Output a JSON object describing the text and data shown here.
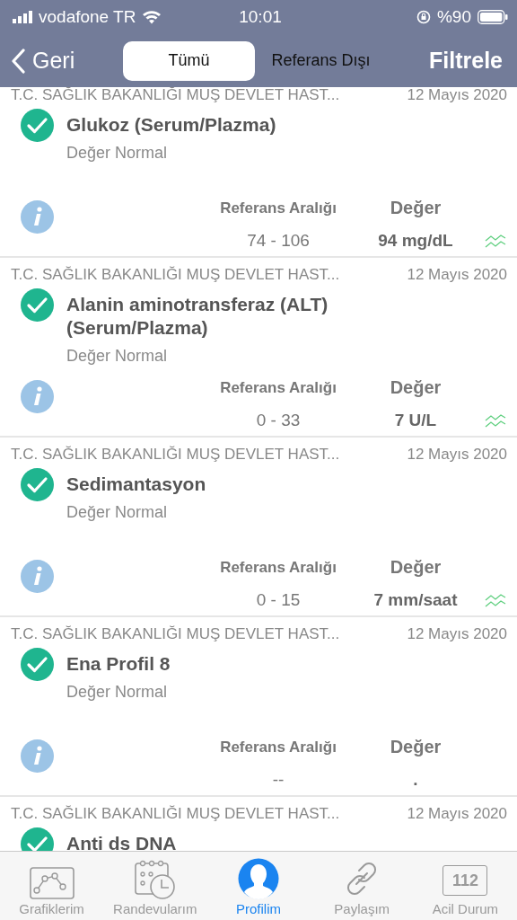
{
  "status_bar": {
    "carrier": "vodafone TR",
    "time": "10:01",
    "battery": "%90"
  },
  "nav": {
    "back": "Geri",
    "action": "Filtrele",
    "tabs": [
      {
        "label": "Tümü",
        "selected": true
      },
      {
        "label": "Referans Dışı",
        "selected": false
      }
    ]
  },
  "results": [
    {
      "source": "T.C. SAĞLIK BAKANLIĞI MUŞ DEVLET HAST...",
      "date": "12 Mayıs 2020",
      "title": "Glukoz (Serum/Plazma)",
      "normal": true,
      "status_text": "Değer Normal",
      "ref_label": "Referans Aralığı",
      "value_label": "Değer",
      "ref": "74 - 106",
      "value": "94 mg/dL",
      "trend": true
    },
    {
      "source": "T.C. SAĞLIK BAKANLIĞI MUŞ DEVLET HAST...",
      "date": "12 Mayıs 2020",
      "title": "Alanin aminotransferaz (ALT) (Serum/Plazma)",
      "normal": true,
      "status_text": "Değer Normal",
      "ref_label": "Referans Aralığı",
      "value_label": "Değer",
      "ref": "0 - 33",
      "value": "7 U/L",
      "trend": true
    },
    {
      "source": "T.C. SAĞLIK BAKANLIĞI MUŞ DEVLET HAST...",
      "date": "12 Mayıs 2020",
      "title": "Sedimantasyon",
      "normal": true,
      "status_text": "Değer Normal",
      "ref_label": "Referans Aralığı",
      "value_label": "Değer",
      "ref": "0 - 15",
      "value": "7 mm/saat",
      "trend": true
    },
    {
      "source": "T.C. SAĞLIK BAKANLIĞI MUŞ DEVLET HAST...",
      "date": "12 Mayıs 2020",
      "title": "Ena Profil 8",
      "normal": true,
      "status_text": "Değer Normal",
      "ref_label": "Referans Aralığı",
      "value_label": "Değer",
      "ref": "--",
      "value": ".",
      "trend": false
    },
    {
      "source": "T.C. SAĞLIK BAKANLIĞI MUŞ DEVLET HAST...",
      "date": "12 Mayıs 2020",
      "title": "Anti ds DNA",
      "normal": true
    }
  ],
  "tab_bar": [
    {
      "label": "Grafiklerim",
      "kind": "chart",
      "selected": false
    },
    {
      "label": "Randevularım",
      "kind": "calendar",
      "selected": false
    },
    {
      "label": "Profilim",
      "kind": "person",
      "selected": true
    },
    {
      "label": "Paylaşım",
      "kind": "link",
      "selected": false
    },
    {
      "label": "Acil Durum",
      "kind": "emergency",
      "badge": "112",
      "selected": false
    }
  ]
}
